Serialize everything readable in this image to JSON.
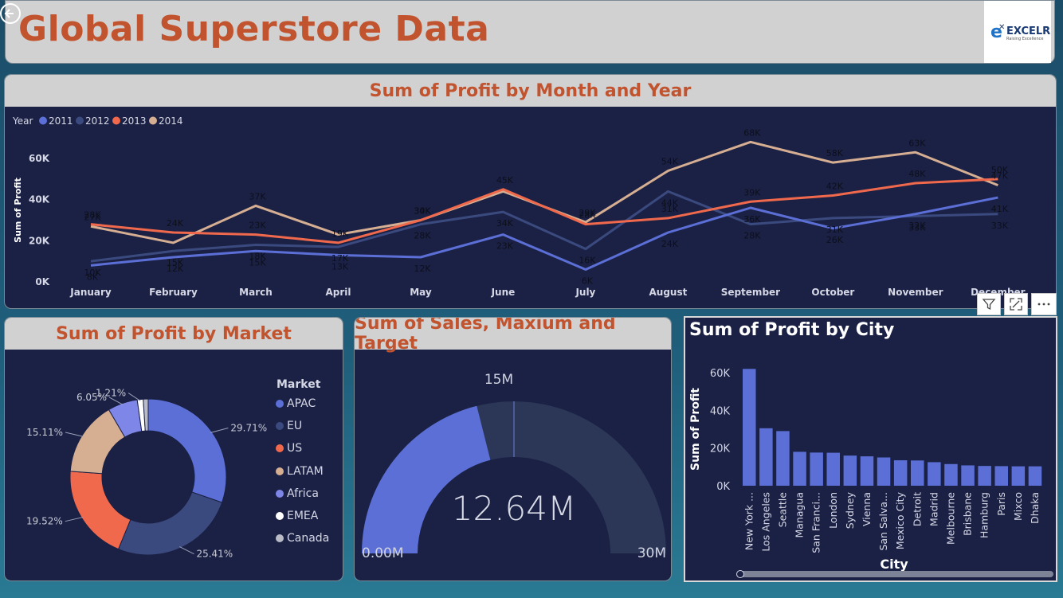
{
  "header": {
    "title": "Global Superstore Data",
    "logo_text": "EXCELR",
    "logo_sub": "Raising Excellence"
  },
  "line_chart": {
    "title": "Sum of Profit by Month and Year",
    "legend_title": "Year",
    "ylabel": "Sum of Profit",
    "y_ticks": [
      "0K",
      "20K",
      "40K",
      "60K"
    ]
  },
  "market_chart": {
    "title": "Sum of Profit by Market",
    "legend_title": "Market"
  },
  "gauge": {
    "title": "Sum of Sales, Maxium and Target",
    "value_label": "12.64M",
    "min_label": "0.00M",
    "max_label": "30M",
    "target_label": "15M",
    "value": 12.64,
    "min": 0,
    "max": 30,
    "target": 15
  },
  "city_chart": {
    "title": "Sum of Profit by City",
    "xlabel": "City",
    "ylabel": "Sum of Profit"
  },
  "colors": {
    "2011": "#5b6fd6",
    "2012": "#3b4a7e",
    "2013": "#f0694c",
    "2014": "#d6ae92",
    "APAC": "#5b6fd6",
    "EU": "#3b4a7e",
    "US": "#f0694c",
    "LATAM": "#d6ae92",
    "Africa": "#7e86e8",
    "EMEA": "#ffffff",
    "Canada": "#b9bcc7",
    "bar": "#5b6fd6",
    "accent": "#c1532e"
  },
  "chart_data": [
    {
      "type": "line",
      "title": "Sum of Profit by Month and Year",
      "xlabel": "",
      "ylabel": "Sum of Profit",
      "categories": [
        "January",
        "February",
        "March",
        "April",
        "May",
        "June",
        "July",
        "August",
        "September",
        "October",
        "November",
        "December"
      ],
      "ylim": [
        0,
        70000
      ],
      "series": [
        {
          "name": "2011",
          "values": [
            8000,
            12000,
            15000,
            13000,
            12000,
            23000,
            6000,
            24000,
            36000,
            26000,
            33000,
            41000
          ],
          "labels": [
            "8K",
            "12K",
            "15K",
            "13K",
            "12K",
            "23K",
            "6K",
            "24K",
            "36K",
            "26K",
            "32K",
            "41K"
          ]
        },
        {
          "name": "2012",
          "values": [
            10000,
            15000,
            18000,
            17000,
            28000,
            34000,
            16000,
            44000,
            28000,
            31000,
            32000,
            33000
          ],
          "labels": [
            "10K",
            "15K",
            "18K",
            "17K",
            "28K",
            "34K",
            "16K",
            "44K",
            "28K",
            "31K",
            "33K",
            "33K"
          ]
        },
        {
          "name": "2013",
          "values": [
            28000,
            24000,
            23000,
            19000,
            30000,
            45000,
            28000,
            31000,
            39000,
            42000,
            48000,
            50000
          ],
          "labels": [
            "28K",
            "24K",
            "23K",
            "19K",
            "34K",
            "45K",
            "28K",
            "31K",
            "39K",
            "42K",
            "48K",
            "50K"
          ]
        },
        {
          "name": "2014",
          "values": [
            27000,
            19000,
            37000,
            23000,
            30000,
            44000,
            29000,
            54000,
            68000,
            58000,
            63000,
            47000
          ],
          "labels": [
            "27K",
            "",
            "37K",
            "",
            "30K",
            "",
            "29K",
            "54K",
            "68K",
            "58K",
            "63K",
            "47K"
          ]
        }
      ],
      "legend": "top-left"
    },
    {
      "type": "pie",
      "title": "Sum of Profit by Market",
      "categories": [
        "APAC",
        "EU",
        "US",
        "LATAM",
        "Africa",
        "EMEA",
        "Canada"
      ],
      "values": [
        29.71,
        25.41,
        19.52,
        15.11,
        6.05,
        1.21,
        1.0
      ],
      "labels": [
        "29.71%",
        "25.41%",
        "19.52%",
        "15.11%",
        "6.05%",
        "1.21%",
        ""
      ],
      "legend": "right"
    },
    {
      "type": "bar",
      "title": "Sum of Profit by City",
      "xlabel": "City",
      "ylabel": "Sum of Profit",
      "ylim": [
        0,
        65000
      ],
      "y_ticks": [
        "0K",
        "20K",
        "40K",
        "60K"
      ],
      "categories": [
        "New York ...",
        "Los Angeles",
        "Seattle",
        "Managua",
        "San Franci...",
        "London",
        "Sydney",
        "Vienna",
        "San Salva...",
        "Mexico City",
        "Detroit",
        "Madrid",
        "Melbourne",
        "Brisbane",
        "Hamburg",
        "Paris",
        "Mixco",
        "Dhaka"
      ],
      "values": [
        62000,
        30500,
        29000,
        18000,
        17600,
        17500,
        16000,
        15600,
        15000,
        13500,
        13400,
        12500,
        11500,
        10800,
        10500,
        10400,
        10300,
        10300
      ]
    }
  ]
}
